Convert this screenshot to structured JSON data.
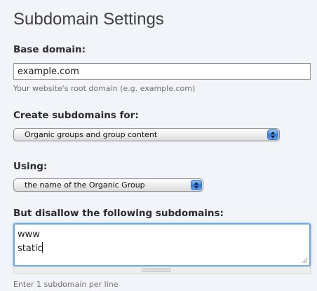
{
  "page": {
    "title": "Subdomain Settings"
  },
  "base_domain": {
    "label": "Base domain:",
    "value": "example.com",
    "help": "Your website's root domain (e.g. example.com)"
  },
  "create_for": {
    "label": "Create subdomains for:",
    "selected": "Organic groups and group content"
  },
  "using": {
    "label": "Using:",
    "selected": "the name of the Organic Group"
  },
  "disallow": {
    "label": "But disallow the following subdomains:",
    "lines": [
      "www",
      "static"
    ],
    "help": "Enter 1 subdomain per line"
  },
  "icons": {
    "select_arrows": "up-down-arrows-icon",
    "resize": "resize-corner-icon",
    "grippie": "drag-handle-icon"
  },
  "colors": {
    "panel_bg": "#f1f5fa",
    "focus_ring": "#6da7e6",
    "select_arrow": "#3d86e0"
  }
}
